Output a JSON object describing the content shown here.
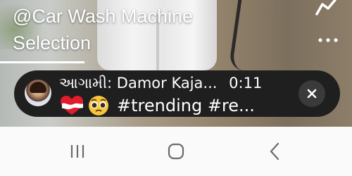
{
  "video": {
    "title_line1": "@Car Wash Machine",
    "title_line2": "Selection",
    "progress_fraction": 0.24
  },
  "upcoming": {
    "prefix": "આગામી:",
    "channel": "Damor Kaja...",
    "time": "0:11",
    "hashtags": "#trending #re..."
  },
  "icons": {
    "share": "share-arrow-icon",
    "more": "more-dots-icon",
    "heart": "broken-heart-emoji",
    "face": "pleading-face-emoji",
    "close": "close-icon",
    "recents": "recents-icon",
    "home": "home-icon",
    "back": "back-chevron-icon"
  },
  "colors": {
    "pill_bg": "#1f1f1f",
    "close_bg": "#3a3a3a",
    "navbar_bg": "#fafafa",
    "nav_icon": "#6b6b6b"
  }
}
